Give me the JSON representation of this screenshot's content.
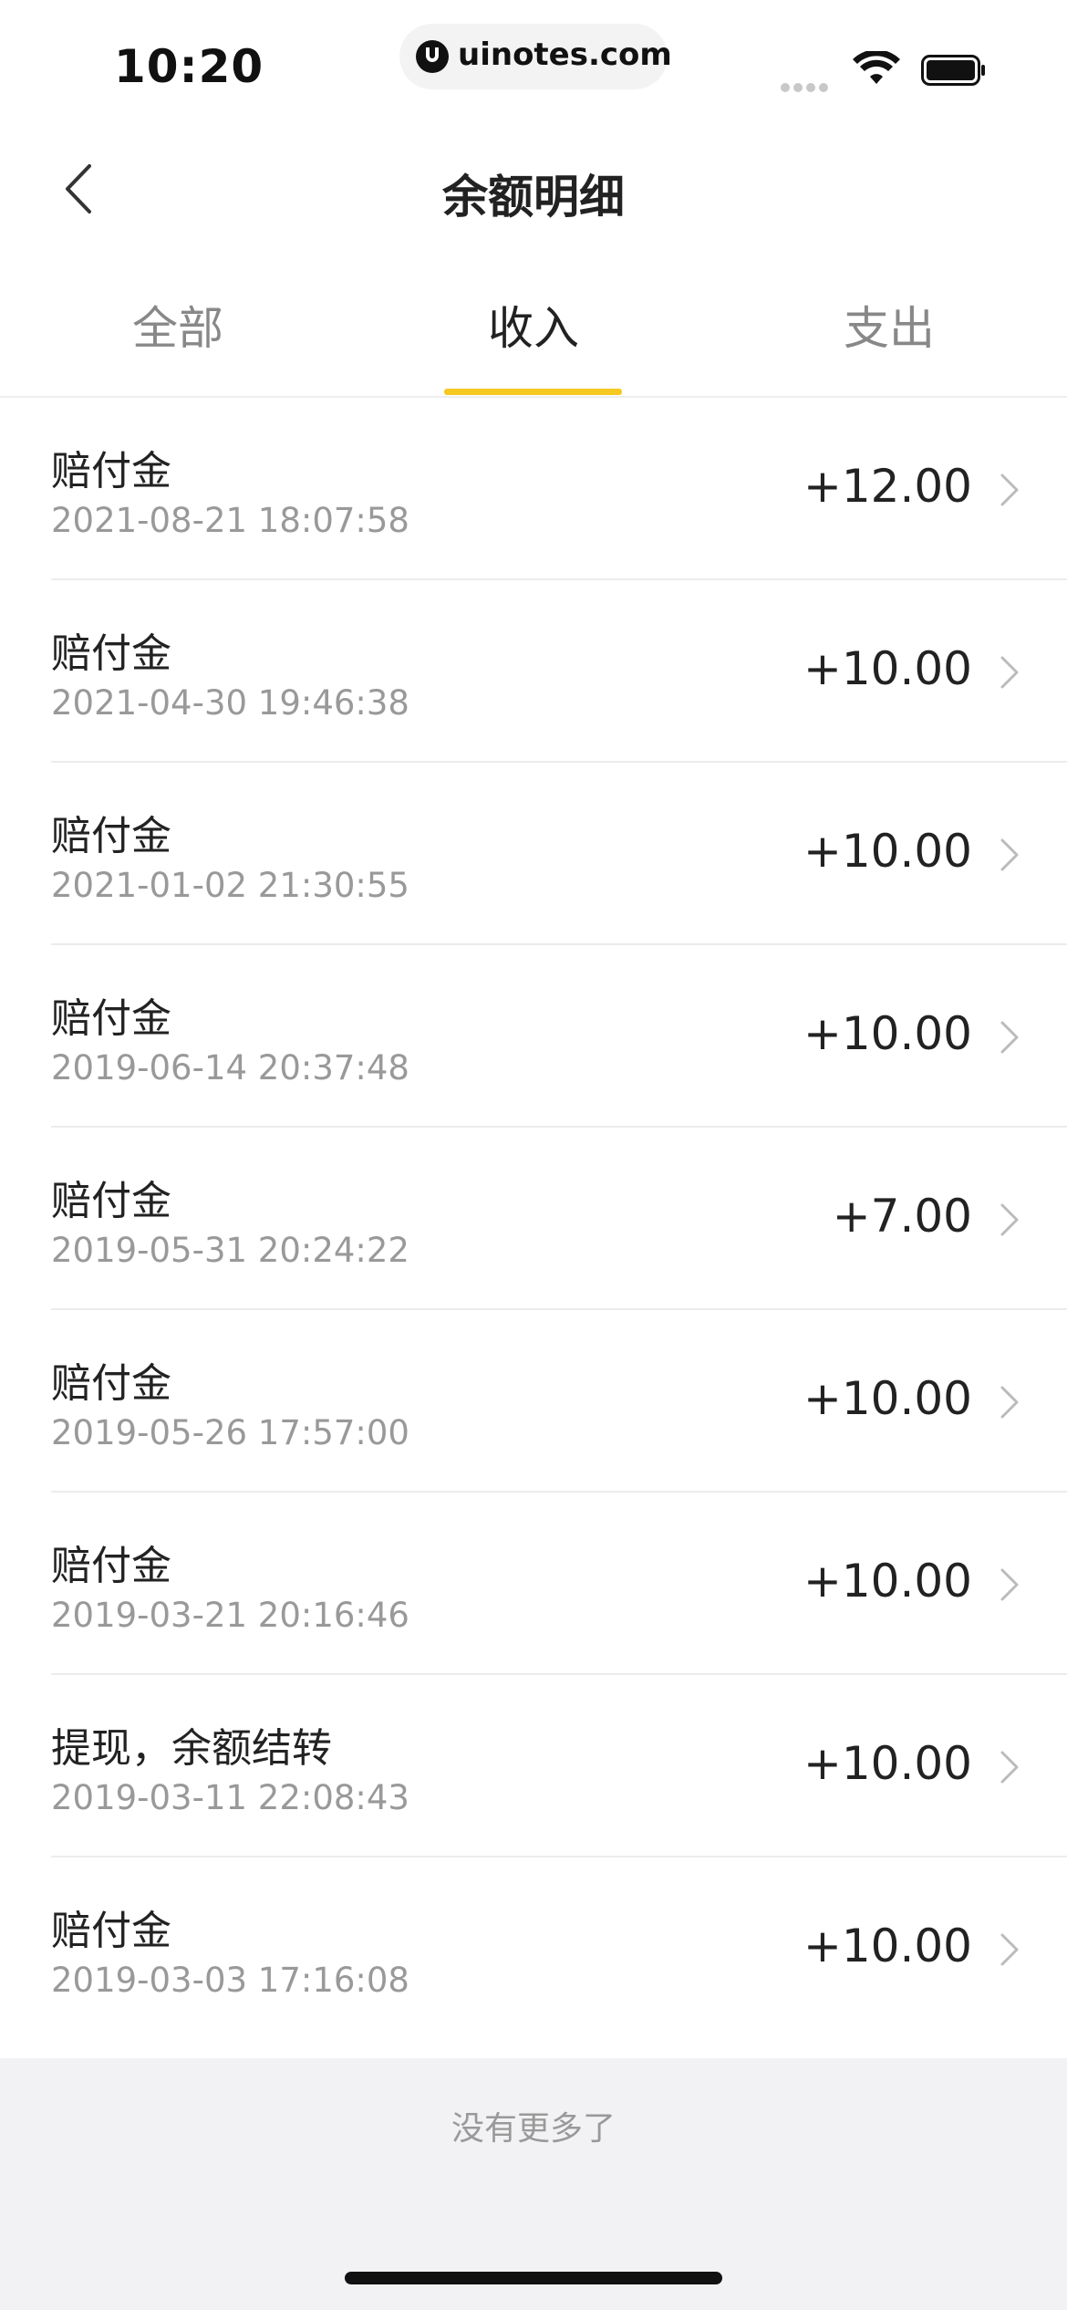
{
  "status_bar": {
    "time": "10:20",
    "url": "uinotes.com"
  },
  "nav": {
    "title": "余额明细"
  },
  "tabs": [
    {
      "label": "全部",
      "active": false
    },
    {
      "label": "收入",
      "active": true
    },
    {
      "label": "支出",
      "active": false
    }
  ],
  "accent_color": "#f5c922",
  "records": [
    {
      "title": "赔付金",
      "date": "2021-08-21 18:07:58",
      "amount": "+12.00"
    },
    {
      "title": "赔付金",
      "date": "2021-04-30 19:46:38",
      "amount": "+10.00"
    },
    {
      "title": "赔付金",
      "date": "2021-01-02 21:30:55",
      "amount": "+10.00"
    },
    {
      "title": "赔付金",
      "date": "2019-06-14 20:37:48",
      "amount": "+10.00"
    },
    {
      "title": "赔付金",
      "date": "2019-05-31 20:24:22",
      "amount": "+7.00"
    },
    {
      "title": "赔付金",
      "date": "2019-05-26 17:57:00",
      "amount": "+10.00"
    },
    {
      "title": "赔付金",
      "date": "2019-03-21 20:16:46",
      "amount": "+10.00"
    },
    {
      "title": "提现，余额结转",
      "date": "2019-03-11 22:08:43",
      "amount": "+10.00"
    },
    {
      "title": "赔付金",
      "date": "2019-03-03 17:16:08",
      "amount": "+10.00"
    }
  ],
  "footer": {
    "no_more": "没有更多了"
  }
}
